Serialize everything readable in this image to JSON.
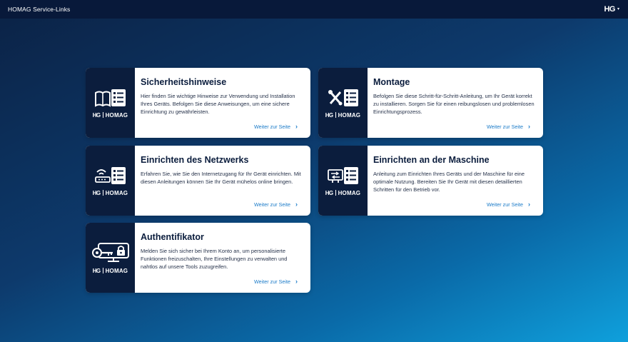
{
  "header": {
    "app_title": "HOMAG Service-Links",
    "brand_logo": "HG",
    "brand_menu_caret": "▾"
  },
  "brand": {
    "mark": "HG",
    "name": "HOMAG"
  },
  "link_chevron": "›",
  "cards": [
    {
      "icon": "book-document-icon",
      "title": "Sicherheitshinweise",
      "description": "Hier finden Sie wichtige Hinweise zur Verwendung und Installation Ihres Geräts. Befolgen Sie diese Anweisungen, um eine sichere Einrichtung zu gewährleisten.",
      "link": "Weiter zur Seite"
    },
    {
      "icon": "tools-document-icon",
      "title": "Montage",
      "description": "Befolgen Sie diese Schritt-für-Schritt-Anleitung, um Ihr Gerät korrekt zu installieren. Sorgen Sie für einen reibungslosen und problemlosen Einrichtungsprozess.",
      "link": "Weiter zur Seite"
    },
    {
      "icon": "router-document-icon",
      "title": "Einrichten des Netzwerks",
      "description": "Erfahren Sie, wie Sie den Internetzugang für Ihr Gerät einrichten. Mit diesen Anleitungen können Sie Ihr Gerät mühelos online bringen.",
      "link": "Weiter zur Seite"
    },
    {
      "icon": "machine-document-icon",
      "title": "Einrichten an der Maschine",
      "description": "Anleitung zum Einrichten Ihres Geräts und der Maschine für eine optimale Nutzung. Bereiten Sie Ihr Gerät mit diesen detaillierten Schritten für den Betrieb vor.",
      "link": "Weiter zur Seite"
    },
    {
      "icon": "key-lock-monitor-icon",
      "title": "Authentifikator",
      "description": "Melden Sie sich sicher bei Ihrem Konto an, um personalisierte Funktionen freizuschalten, Ihre Einstellungen zu verwalten und nahtlos auf unsere Tools zuzugreifen.",
      "link": "Weiter zur Seite"
    }
  ]
}
